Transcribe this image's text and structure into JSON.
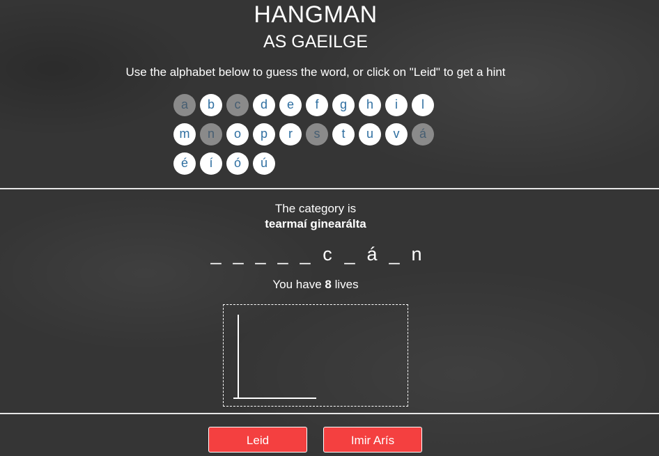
{
  "header": {
    "title": "HANGMAN",
    "subtitle": "AS GAEILGE",
    "instructions": "Use the alphabet below to guess the word, or click on \"Leid\" to get a hint"
  },
  "alphabet": [
    {
      "letter": "a",
      "used": true
    },
    {
      "letter": "b",
      "used": false
    },
    {
      "letter": "c",
      "used": true
    },
    {
      "letter": "d",
      "used": false
    },
    {
      "letter": "e",
      "used": false
    },
    {
      "letter": "f",
      "used": false
    },
    {
      "letter": "g",
      "used": false
    },
    {
      "letter": "h",
      "used": false
    },
    {
      "letter": "i",
      "used": false
    },
    {
      "letter": "l",
      "used": false
    },
    {
      "letter": "m",
      "used": false
    },
    {
      "letter": "n",
      "used": true
    },
    {
      "letter": "o",
      "used": false
    },
    {
      "letter": "p",
      "used": false
    },
    {
      "letter": "r",
      "used": false
    },
    {
      "letter": "s",
      "used": true
    },
    {
      "letter": "t",
      "used": false
    },
    {
      "letter": "u",
      "used": false
    },
    {
      "letter": "v",
      "used": false
    },
    {
      "letter": "á",
      "used": true
    },
    {
      "letter": "é",
      "used": false
    },
    {
      "letter": "í",
      "used": false
    },
    {
      "letter": "ó",
      "used": false
    },
    {
      "letter": "ú",
      "used": false
    }
  ],
  "game": {
    "category_label": "The category is",
    "category_value": "tearmaí ginearálta",
    "word_slots": [
      "_",
      "_",
      "_",
      "_",
      "_",
      "c",
      "_",
      "á",
      "_",
      "n"
    ],
    "lives_prefix": "You have",
    "lives_count": "8",
    "lives_suffix": "lives"
  },
  "buttons": {
    "hint_label": "Leid",
    "replay_label": "Imir Arís"
  },
  "colors": {
    "letter_text": "#2f6fa1",
    "button_bg": "#f44040"
  }
}
